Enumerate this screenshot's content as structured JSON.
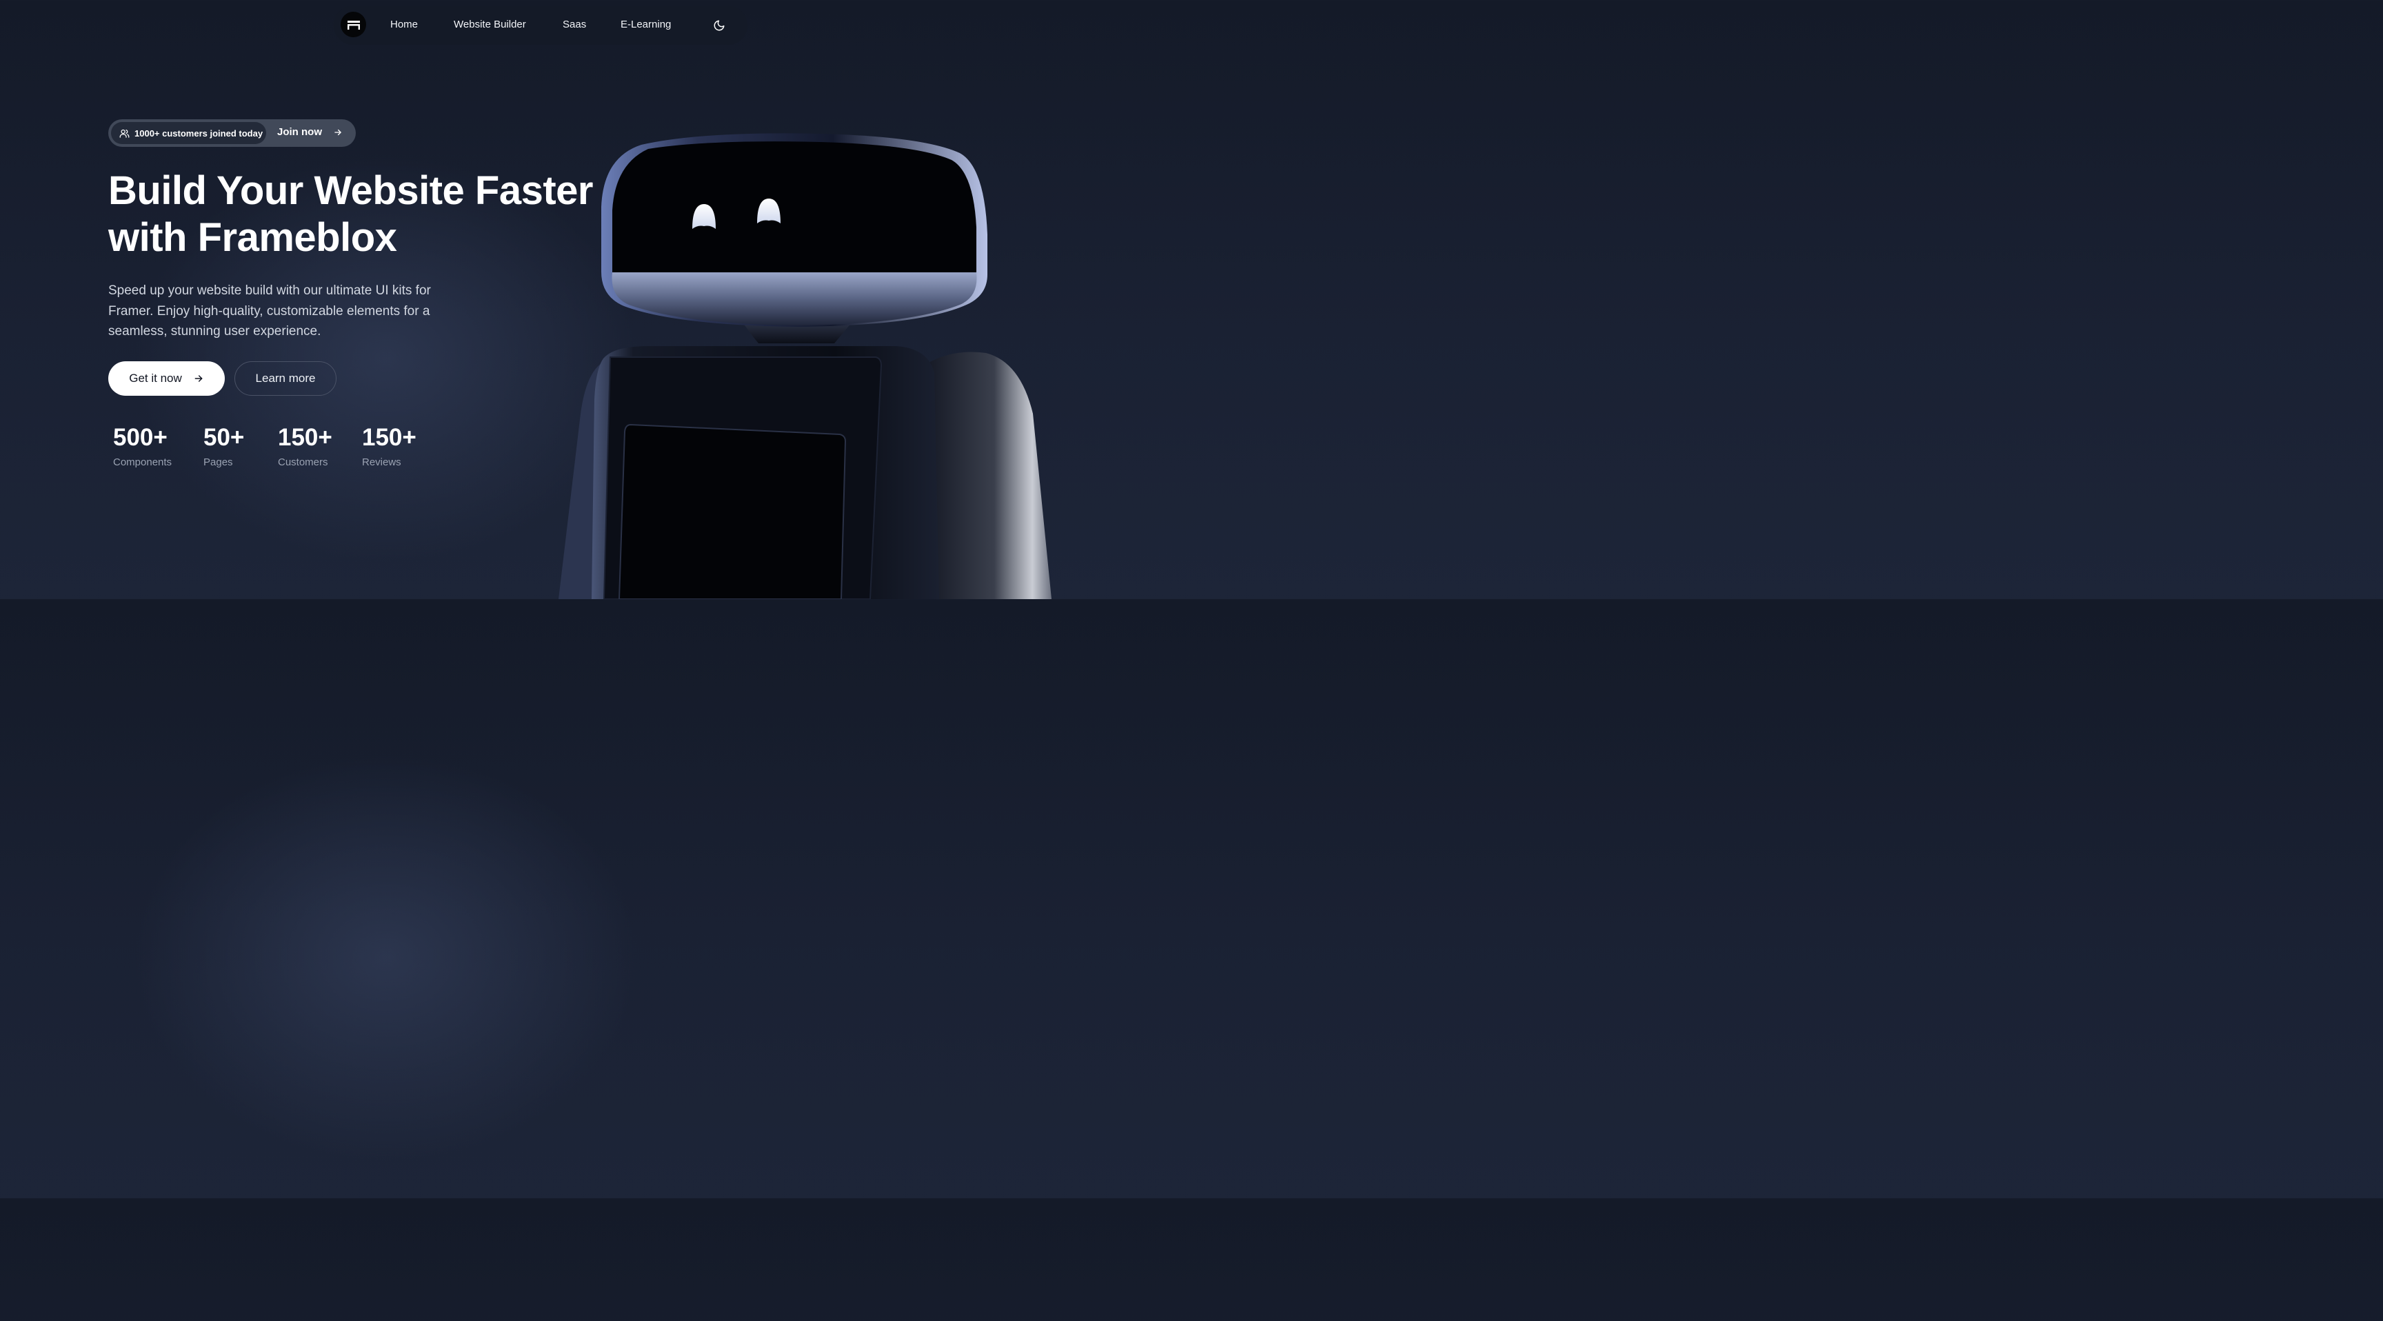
{
  "nav": {
    "logo_icon": "frameblox-logo-icon",
    "links": [
      {
        "label": "Home"
      },
      {
        "label": "Website Builder"
      },
      {
        "label": "Saas"
      },
      {
        "label": "E-Learning"
      }
    ],
    "theme_icon": "moon-icon"
  },
  "announcement": {
    "icon": "users-icon",
    "text": "1000+ customers joined today",
    "cta": "Join now",
    "cta_icon": "arrow-right-icon"
  },
  "hero": {
    "title_line1": "Build Your Website Faster",
    "title_line2": "with Frameblox",
    "description": "Speed up your website build with our ultimate UI kits for Framer. Enjoy high-quality, customizable elements for a seamless, stunning user experience.",
    "primary_cta": "Get it now",
    "secondary_cta": "Learn more"
  },
  "stats": [
    {
      "value": "500+",
      "label": "Components"
    },
    {
      "value": "50+",
      "label": "Pages"
    },
    {
      "value": "150+",
      "label": "Customers"
    },
    {
      "value": "150+",
      "label": "Reviews"
    }
  ],
  "colors": {
    "background": "#1a2133",
    "nav_background": "#141a27",
    "primary_button": "#ffffff",
    "muted_text": "#9aa2b2"
  }
}
